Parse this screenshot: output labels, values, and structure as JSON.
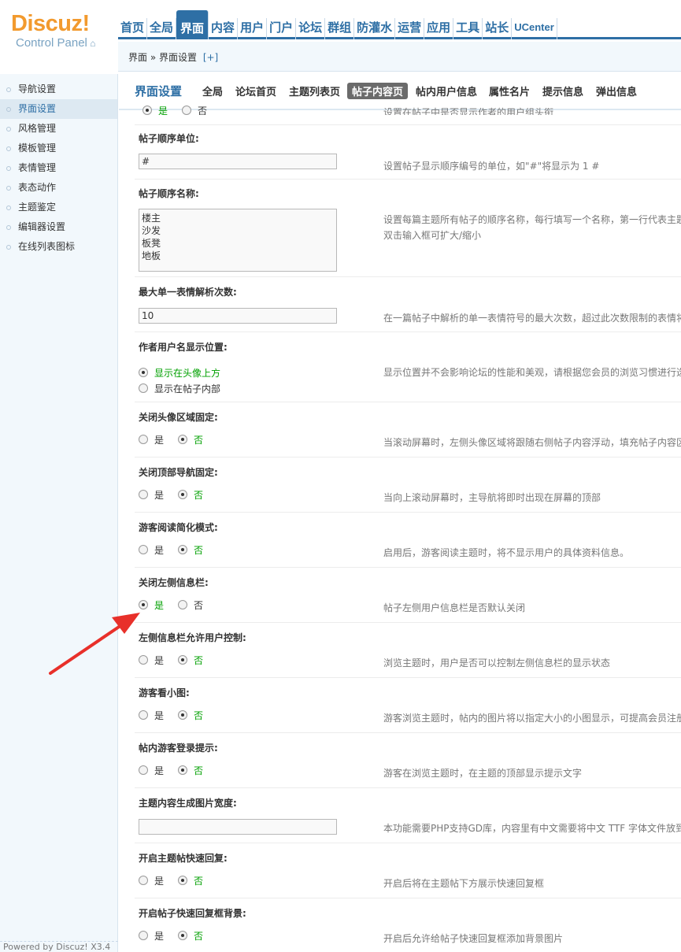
{
  "logo": {
    "main": "Discuz!",
    "sub": "Control Panel"
  },
  "topnav": [
    "首页",
    "全局",
    "界面",
    "内容",
    "用户",
    "门户",
    "论坛",
    "群组",
    "防灌水",
    "运营",
    "应用",
    "工具",
    "站长",
    "UCenter"
  ],
  "topnav_active": "界面",
  "breadcrumb": {
    "text": "界面 » 界面设置",
    "plus": "[+]"
  },
  "sidebar": {
    "items": [
      "导航设置",
      "界面设置",
      "风格管理",
      "模板管理",
      "表情管理",
      "表态动作",
      "主题鉴定",
      "编辑器设置",
      "在线列表图标"
    ],
    "active": "界面设置",
    "footer": "Powered by Discuz! X3.4"
  },
  "main": {
    "title": "界面设置",
    "tabs": [
      "全局",
      "论坛首页",
      "主题列表页",
      "帖子内容页",
      "帖内用户信息",
      "属性名片",
      "提示信息",
      "弹出信息"
    ],
    "active_tab": "帖子内容页"
  },
  "settings": {
    "partial": {
      "yes": "是",
      "no": "否",
      "desc": "设置在帖子中是否显示作者的用户组头衔"
    },
    "order_unit": {
      "label": "帖子顺序单位:",
      "value": "#",
      "desc": "设置帖子显示顺序编号的单位，如\"#\"将显示为 1 #"
    },
    "order_names": {
      "label": "帖子顺序名称:",
      "value": "楼主\n沙发\n板凳\n地板",
      "desc1": "设置每篇主题所有帖子的顺序名称，每行填写一个名称，第一行代表主题",
      "desc2": "双击输入框可扩大/缩小"
    },
    "max_smilies": {
      "label": "最大单一表情解析次数:",
      "value": "10",
      "desc": "在一篇帖子中解析的单一表情符号的最大次数，超过此次数限制的表情将"
    },
    "author_pos": {
      "label": "作者用户名显示位置:",
      "opt1": "显示在头像上方",
      "opt2": "显示在帖子内部",
      "desc": "显示位置并不会影响论坛的性能和美观，请根据您会员的浏览习惯进行选"
    },
    "avatar_fixed": {
      "label": "关闭头像区域固定:",
      "yes": "是",
      "no": "否",
      "desc": "当滚动屏幕时，左侧头像区域将跟随右侧帖子内容浮动，填充帖子内容区"
    },
    "nav_fixed": {
      "label": "关闭顶部导航固定:",
      "yes": "是",
      "no": "否",
      "desc": "当向上滚动屏幕时，主导航将即时出现在屏幕的顶部"
    },
    "guest_simple": {
      "label": "游客阅读简化模式:",
      "yes": "是",
      "no": "否",
      "desc": "启用后，游客阅读主题时，将不显示用户的具体资料信息。"
    },
    "close_left_info": {
      "label": "关闭左侧信息栏:",
      "yes": "是",
      "no": "否",
      "desc": "帖子左侧用户信息栏是否默认关闭"
    },
    "left_info_user": {
      "label": "左侧信息栏允许用户控制:",
      "yes": "是",
      "no": "否",
      "desc": "浏览主题时，用户是否可以控制左侧信息栏的显示状态"
    },
    "guest_thumb": {
      "label": "游客看小图:",
      "yes": "是",
      "no": "否",
      "desc": "游客浏览主题时，帖内的图片将以指定大小的小图显示，可提高会员注册"
    },
    "guest_login_tip": {
      "label": "帖内游客登录提示:",
      "yes": "是",
      "no": "否",
      "desc": "游客在浏览主题时，在主题的顶部显示提示文字"
    },
    "image_width": {
      "label": "主题内容生成图片宽度:",
      "value": "",
      "desc": "本功能需要PHP支持GD库，内容里有中文需要将中文 TTF 字体文件放到"
    },
    "fast_reply": {
      "label": "开启主题帖快速回复:",
      "yes": "是",
      "no": "否",
      "desc": "开启后将在主题帖下方展示快速回复框"
    },
    "fast_reply_bg": {
      "label": "开启帖子快速回复框背景:",
      "yes": "是",
      "no": "否",
      "desc": "开启后允许给帖子快速回复框添加背景图片"
    }
  },
  "colors": {
    "brand_blue": "#2e6fa5",
    "logo_orange": "#f29a2e",
    "selected_green": "#00a000",
    "annotation_red": "#e8302a"
  }
}
